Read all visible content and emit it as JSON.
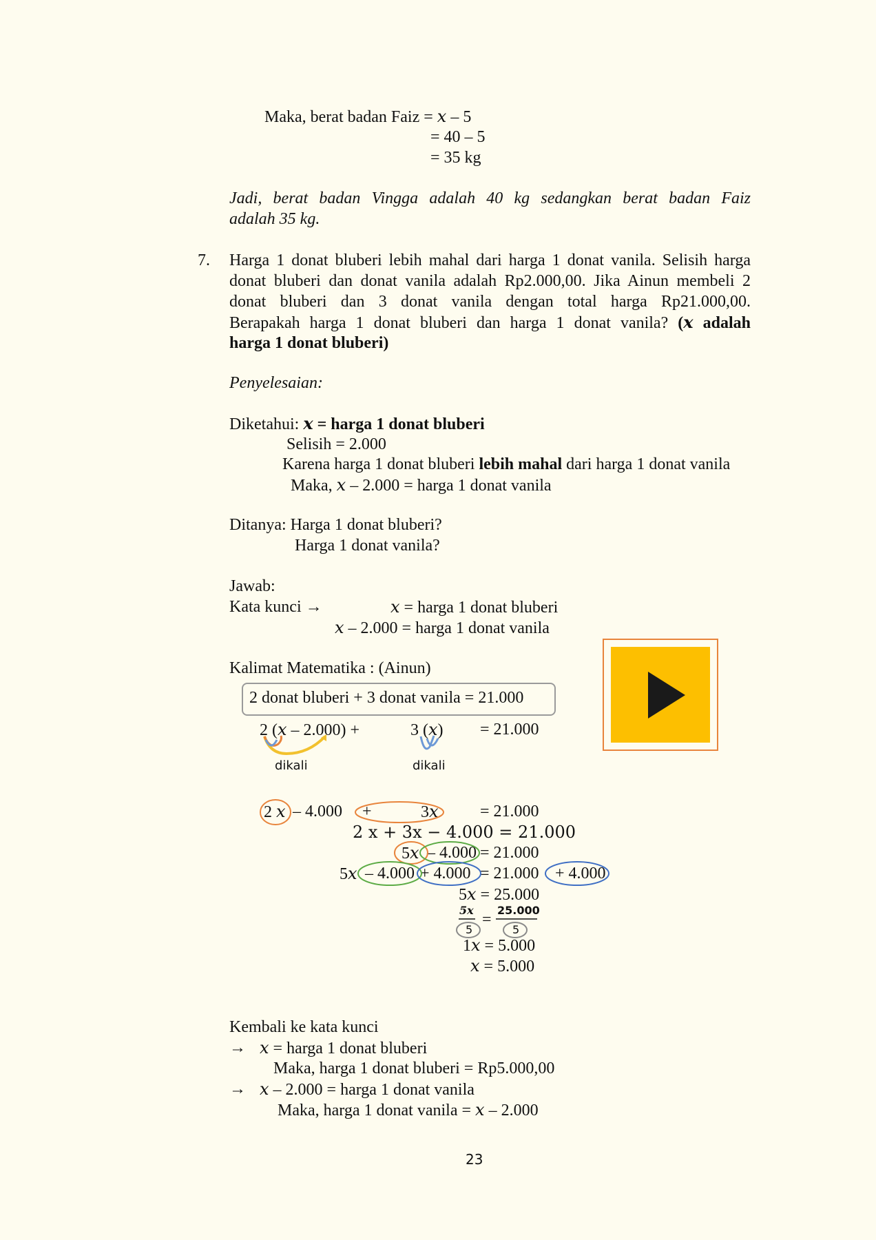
{
  "top": {
    "line1_prefix": "Maka, berat badan Faiz = ",
    "line1_var": "x",
    "line1_suffix": " – 5",
    "line2": "= 40 – 5",
    "line3": "= 35 kg",
    "conclusion_l1": "Jadi, berat badan Vingga adalah 40 kg sedangkan berat badan Faiz",
    "conclusion_l2": "adalah 35 kg."
  },
  "problem": {
    "number": "7.",
    "l1": "Harga 1 donat bluberi lebih mahal dari harga 1 donat vanila. Selisih harga",
    "l2": "donat bluberi dan donat vanila adalah Rp2.000,00. Jika Ainun membeli 2",
    "l3": "donat bluberi dan 3 donat vanila dengan total harga  Rp21.000,00.",
    "l4_text": "Berapakah harga 1 donat bluberi dan harga 1 donat vanila?",
    "l4_open": " (",
    "l4_var": "x",
    "l4_bold": " adalah",
    "l5_bold": "harga 1 donat bluberi)"
  },
  "solution": {
    "heading": "Penyelesaian:",
    "diketahui_label": "Diketahui: ",
    "diketahui_var": "x",
    "diketahui_bold": " = harga 1 donat bluberi",
    "selisih": "Selisih = 2.000",
    "karena_pre": "Karena harga 1 donat bluberi ",
    "karena_bold": "lebih mahal",
    "karena_post": " dari harga 1 donat vanila",
    "maka_pre": "Maka, ",
    "maka_var": "x",
    "maka_post": " – 2.000 = harga 1 donat vanila",
    "ditanya_label": "Ditanya: Harga 1 donat bluberi?",
    "ditanya_2": "Harga 1 donat vanila?",
    "jawab": "Jawab:",
    "kata_kunci": "Kata kunci →",
    "kk1_var": "x",
    "kk1_text": " = harga 1 donat bluberi",
    "kk2_var": "x",
    "kk2_text": " – 2.000 = harga 1 donat vanila",
    "kalimat": "Kalimat Matematika : (Ainun)",
    "boxed": "2 donat bluberi + 3 donat vanila  = 21.000",
    "eq1_a": "2 (",
    "eq1_var": "x",
    "eq1_b": " – 2.000)  +",
    "eq1_c": "3 (",
    "eq1_var2": "x",
    "eq1_d": ")",
    "eq1_rhs": "= 21.000",
    "dikali": "dikali",
    "dikali2": "dikali",
    "s1_a": "2 ",
    "s1_var": "x",
    "s1_b": "– 4.000",
    "s1_plus": "+",
    "s1_c": "3",
    "s1_var2": "x",
    "s1_rhs": "= 21.000",
    "s2": "2 x + 3x − 4.000 = 21.000",
    "s3_a": "5",
    "s3_var": "x",
    "s3_b": "– 4.000",
    "s3_rhs": "= 21.000",
    "s4_a": "5",
    "s4_var": "x",
    "s4_b": "– 4.000",
    "s4_c": "+ 4.000",
    "s4_d": "= 21.000",
    "s4_e": "+ 4.000",
    "s5_a": "5",
    "s5_var": "x",
    "s5_b": " =  25.000",
    "frac_num_l": "5x",
    "frac_den_l": "5",
    "frac_eq": "=",
    "frac_num_r": "25.000",
    "frac_den_r": "5",
    "s7_a": "1",
    "s7_var": "x",
    "s7_b": " = 5.000",
    "s8_var": "x",
    "s8_b": "  = 5.000",
    "kembali": "Kembali ke kata kunci",
    "arrow1": "→",
    "k1_var": "x",
    "k1_text": " = harga 1 donat bluberi",
    "k1_maka": "Maka, harga 1 donat bluberi = Rp5.000,00",
    "arrow2": "→",
    "k2_var": "x",
    "k2_text": " – 2.000 = harga 1 donat vanila",
    "k2_maka_pre": "Maka, harga 1 donat vanila = ",
    "k2_maka_var": "x",
    "k2_maka_post": " – 2.000"
  },
  "page_number": "23",
  "colors": {
    "background": "#fefcef",
    "orange": "#e8843c",
    "green": "#5cab45",
    "blue": "#3f6fc4",
    "play_fill": "#fdbf00"
  },
  "icons": {
    "play": "play-icon"
  }
}
